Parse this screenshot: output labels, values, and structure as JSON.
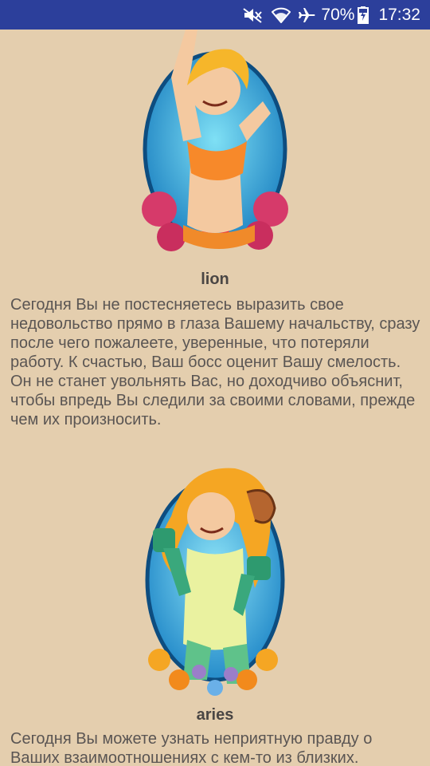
{
  "status_bar": {
    "battery": "70%",
    "time": "17:32",
    "icons": [
      "mute-icon",
      "wifi-icon",
      "airplane-icon",
      "battery-icon"
    ]
  },
  "horoscopes": [
    {
      "name": "lion",
      "text": "Сегодня Вы не постесняетесь выразить свое недовольство прямо в глаза Вашему начальству, сразу после чего пожалеете, уверенные, что потеряли работу. К счастью, Ваш босс оценит Вашу смелость. Он не станет увольнять Вас, но доходчиво объяснит, чтобы впредь Вы следили за своими словами, прежде чем их произносить."
    },
    {
      "name": "aries",
      "text": "Сегодня Вы можете узнать неприятную правду о Ваших взаимоотношениях с кем-то из близких."
    }
  ],
  "colors": {
    "background": "#e4ceae",
    "status_bar": "#2c3f9b",
    "title_text": "#4a4644",
    "body_text": "#5a5553"
  }
}
